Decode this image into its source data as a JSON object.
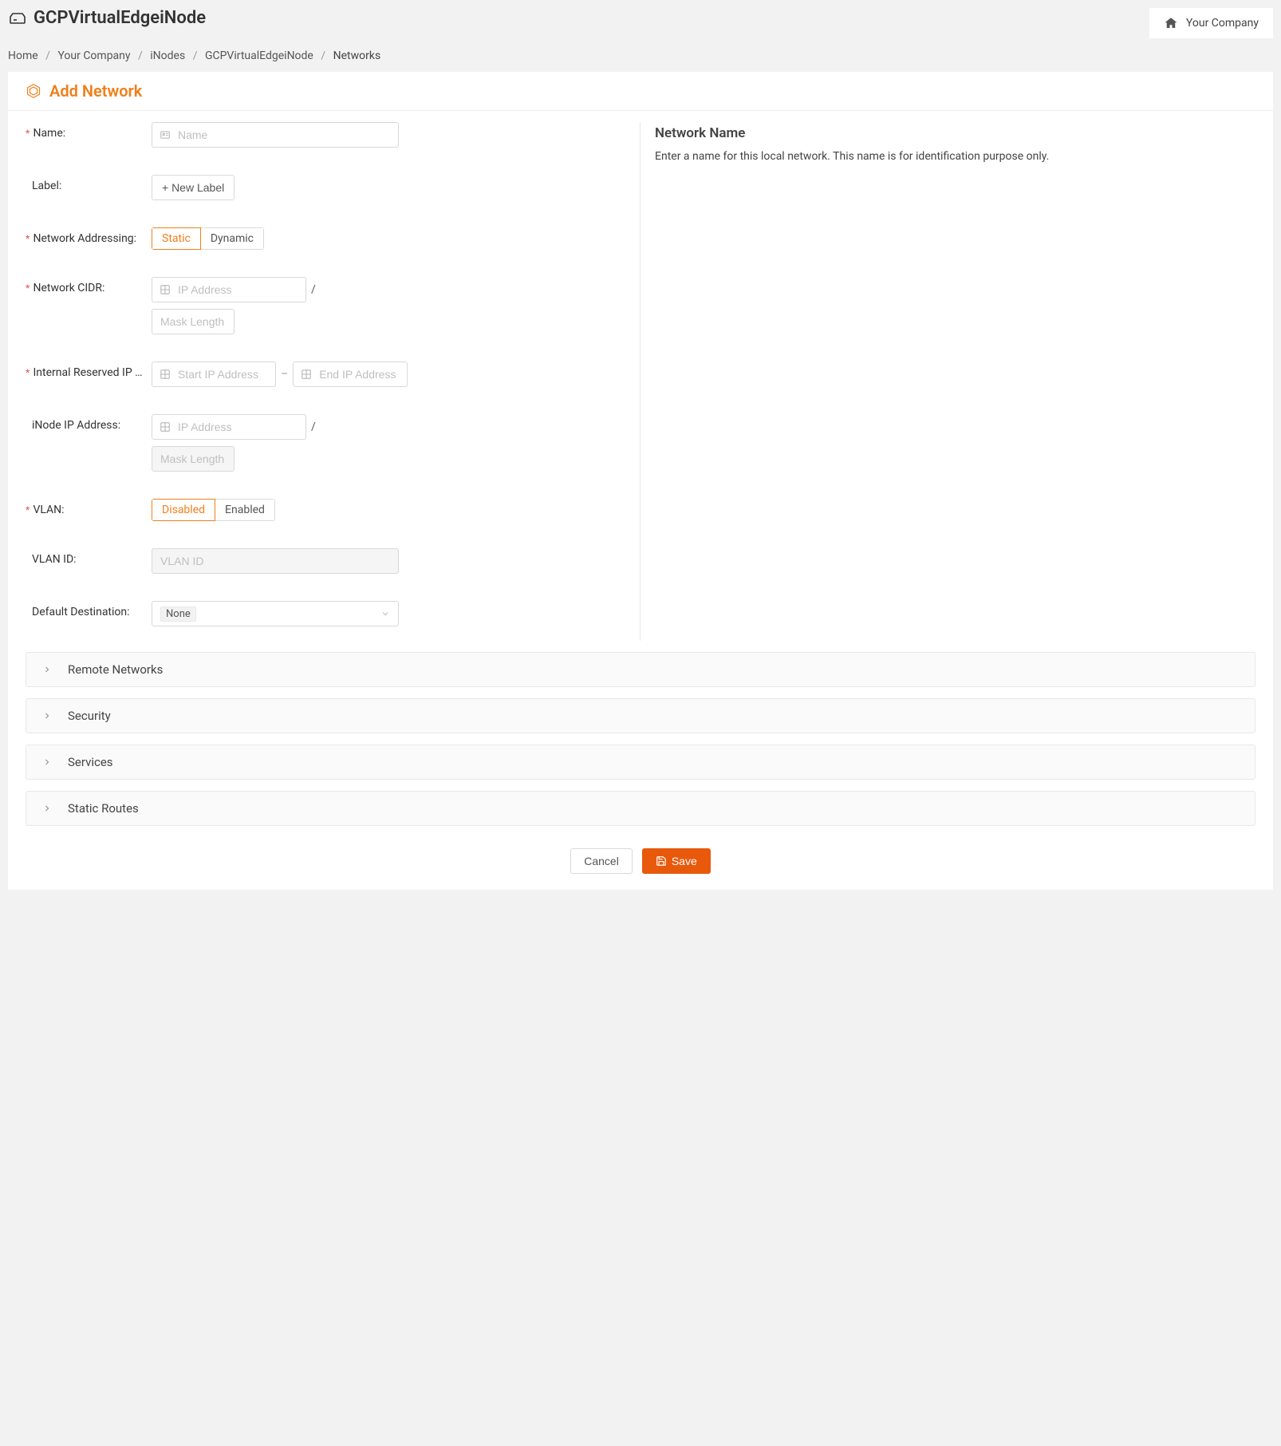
{
  "header": {
    "title": "GCPVirtualEdgeiNode",
    "company_label": "Your Company"
  },
  "breadcrumb": {
    "items": [
      "Home",
      "Your Company",
      "iNodes",
      "GCPVirtualEdgeiNode"
    ],
    "current": "Networks"
  },
  "page": {
    "title": "Add Network"
  },
  "help": {
    "title": "Network Name",
    "text": "Enter a name for this local network. This name is for identification purpose only."
  },
  "form": {
    "name": {
      "label": "Name",
      "placeholder": "Name"
    },
    "label": {
      "label": "Label",
      "button": "+ New Label"
    },
    "addressing": {
      "label": "Network Addressing",
      "opt_static": "Static",
      "opt_dynamic": "Dynamic"
    },
    "cidr": {
      "label": "Network CIDR",
      "ip_placeholder": "IP Address",
      "mask_placeholder": "Mask Length"
    },
    "reserved": {
      "label": "Internal Reserved IP A...",
      "start_placeholder": "Start IP Address",
      "end_placeholder": "End IP Address"
    },
    "inode_ip": {
      "label": "iNode IP Address",
      "ip_placeholder": "IP Address",
      "mask_placeholder": "Mask Length"
    },
    "vlan": {
      "label": "VLAN",
      "opt_disabled": "Disabled",
      "opt_enabled": "Enabled"
    },
    "vlan_id": {
      "label": "VLAN ID",
      "placeholder": "VLAN ID"
    },
    "default_dest": {
      "label": "Default Destination",
      "value": "None"
    }
  },
  "accordions": {
    "remote": "Remote Networks",
    "security": "Security",
    "services": "Services",
    "routes": "Static Routes"
  },
  "actions": {
    "cancel": "Cancel",
    "save": "Save"
  }
}
